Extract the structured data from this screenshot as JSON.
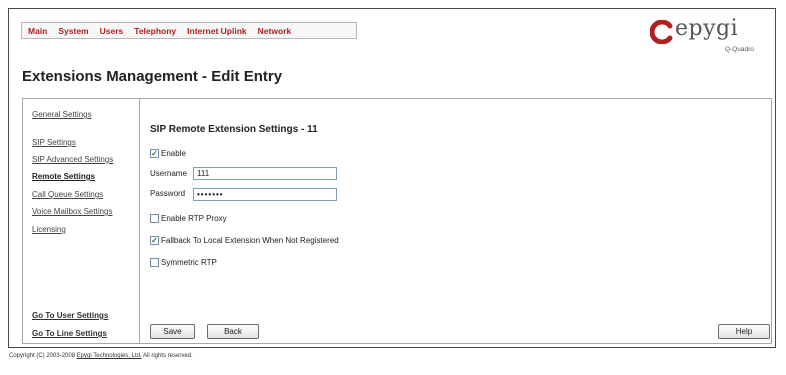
{
  "nav": {
    "items": [
      {
        "label": "Main"
      },
      {
        "label": "System"
      },
      {
        "label": "Users"
      },
      {
        "label": "Telephony"
      },
      {
        "label": "Internet Uplink"
      },
      {
        "label": "Network"
      }
    ]
  },
  "logo": {
    "word": "epygi",
    "sub": "Q-Quadro",
    "icon": "epygi-logo-icon",
    "color": "#b22020"
  },
  "page": {
    "title": "Extensions Management - Edit Entry"
  },
  "sidebar": {
    "items": [
      {
        "label": "General Settings"
      },
      {
        "label": "SIP Settings"
      },
      {
        "label": "SIP Advanced Settings"
      },
      {
        "label": "Remote Settings"
      },
      {
        "label": "Call Queue Settings"
      },
      {
        "label": "Voice Mailbox Settings"
      },
      {
        "label": "Licensing"
      }
    ],
    "bottom": [
      {
        "label": "Go To User Settings"
      },
      {
        "label": "Go To Line Settings"
      }
    ]
  },
  "form": {
    "section_title": "SIP Remote Extension Settings - 11",
    "enable": {
      "label": "Enable",
      "checked": true
    },
    "username": {
      "label": "Username",
      "value": "111"
    },
    "password": {
      "label": "Password",
      "value": "•••••••"
    },
    "rtp_proxy": {
      "label": "Enable RTP Proxy",
      "checked": false
    },
    "fallback": {
      "label": "Fallback To Local Extension When Not Registered",
      "checked": true
    },
    "symmetric_rtp": {
      "label": "Symmetric RTP",
      "checked": false
    },
    "save_label": "Save",
    "back_label": "Back",
    "help_label": "Help"
  },
  "footer": {
    "prefix": "Copyright (C) 2003-2008",
    "link": "Epygi Technologies, Ltd.",
    "suffix": "All rights reserved."
  }
}
